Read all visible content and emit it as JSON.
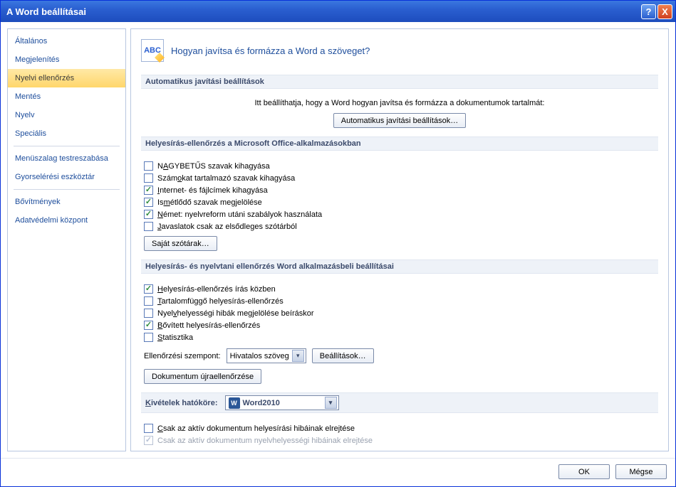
{
  "title": "A Word beállításai",
  "titlebar": {
    "help": "?",
    "close": "X"
  },
  "sidebar": {
    "items": [
      {
        "label": "Általános",
        "selected": false
      },
      {
        "label": "Megjelenítés",
        "selected": false
      },
      {
        "label": "Nyelvi ellenőrzés",
        "selected": true
      },
      {
        "label": "Mentés",
        "selected": false
      },
      {
        "label": "Nyelv",
        "selected": false
      },
      {
        "label": "Speciális",
        "selected": false
      },
      {
        "sep": true
      },
      {
        "label": "Menüszalag testreszabása",
        "selected": false
      },
      {
        "label": "Gyorselérési eszköztár",
        "selected": false
      },
      {
        "sep": true
      },
      {
        "label": "Bővítmények",
        "selected": false
      },
      {
        "label": "Adatvédelmi központ",
        "selected": false
      }
    ]
  },
  "heading": {
    "icon_label": "ABC",
    "text": "Hogyan javítsa és formázza a Word a szöveget?"
  },
  "section_autocorrect": {
    "header": "Automatikus javítási beállítások",
    "desc": "Itt beállíthatja, hogy a Word hogyan javítsa és formázza a dokumentumok tartalmát:",
    "button": "Automatikus javítási beállítások…"
  },
  "section_spellcheck_office": {
    "header": "Helyesírás-ellenőrzés a Microsoft Office-alkalmazásokban",
    "checks": [
      {
        "label_html": "N<span class=\"u\">A</span>GYBETŰS szavak kihagyása",
        "checked": false
      },
      {
        "label_html": "Szám<span class=\"u\">o</span>kat tartalmazó szavak kihagyása",
        "checked": false
      },
      {
        "label_html": "<span class=\"u\">I</span>nternet- és fájlcímek kihagyása",
        "checked": true
      },
      {
        "label_html": "Is<span class=\"u\">m</span>étlődő szavak megjelölése",
        "checked": true
      },
      {
        "label_html": "<span class=\"u\">N</span>émet: nyelvreform utáni szabályok használata",
        "checked": true
      },
      {
        "label_html": "<span class=\"u\">J</span>avaslatok csak az elsődleges szótárból",
        "checked": false
      }
    ],
    "dict_button": "Saját szótárak…"
  },
  "section_spellcheck_word": {
    "header": "Helyesírás- és nyelvtani ellenőrzés Word alkalmazásbeli beállításai",
    "checks": [
      {
        "label_html": "<span class=\"u\">H</span>elyesírás-ellenőrzés írás közben",
        "checked": true
      },
      {
        "label_html": "<span class=\"u\">T</span>artalomfüggő helyesírás-ellenőrzés",
        "checked": false
      },
      {
        "label_html": "Nyel<span class=\"u\">v</span>helyességi hibák megjelölése beíráskor",
        "checked": false
      },
      {
        "label_html": "<span class=\"u\">B</span>ővített helyesírás-ellenőrzés",
        "checked": true
      },
      {
        "label_html": "<span class=\"u\">S</span>tatisztika",
        "checked": false
      }
    ],
    "aspect_label": "Ellenőrzési szempont:",
    "aspect_value": "Hivatalos szöveg",
    "settings_button": "Beállítások…",
    "recheck_button": "Dokumentum újraellenőrzése"
  },
  "section_exceptions": {
    "label": "Kivételek hatóköre:",
    "value": "Word2010",
    "checks": [
      {
        "label_html": "<span class=\"u\">C</span>sak az aktív dokumentum helyesírási hibáinak elrejtése",
        "checked": false,
        "disabled": false
      },
      {
        "label_html": "Csak az aktív dokumentum nyelvhelyességi hibáinak elrejtése",
        "checked": true,
        "disabled": true
      }
    ]
  },
  "footer": {
    "ok": "OK",
    "cancel": "Mégse"
  }
}
